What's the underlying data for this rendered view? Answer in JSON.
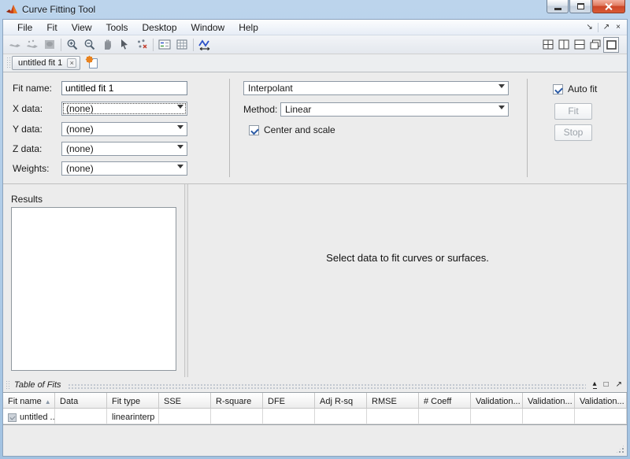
{
  "titlebar": {
    "title": "Curve Fitting Tool"
  },
  "menubar": {
    "items": [
      "File",
      "Fit",
      "View",
      "Tools",
      "Desktop",
      "Window",
      "Help"
    ],
    "dock_glyph": "↘",
    "undock_glyph": "↗",
    "close_glyph": "×"
  },
  "tabbar": {
    "active_tab": "untitled fit 1",
    "close_glyph": "×"
  },
  "fit_panel": {
    "fit_name_label": "Fit name:",
    "fit_name_value": "untitled fit 1",
    "x_data_label": "X data:",
    "x_data_value": "(none)",
    "y_data_label": "Y data:",
    "y_data_value": "(none)",
    "z_data_label": "Z data:",
    "z_data_value": "(none)",
    "weights_label": "Weights:",
    "weights_value": "(none)",
    "fit_type_value": "Interpolant",
    "method_label": "Method:",
    "method_value": "Linear",
    "center_scale_label": "Center and scale",
    "auto_fit_label": "Auto fit",
    "fit_button_label": "Fit",
    "stop_button_label": "Stop"
  },
  "results_panel": {
    "label": "Results"
  },
  "plot_panel": {
    "message": "Select data to fit curves or surfaces."
  },
  "table_of_fits": {
    "title": "Table of Fits",
    "sort_glyph": "▲",
    "collapse_glyph": "▴",
    "maximize_glyph": "□",
    "undock_glyph": "↗",
    "columns": [
      "Fit name",
      "Data",
      "Fit type",
      "SSE",
      "R-square",
      "DFE",
      "Adj R-sq",
      "RMSE",
      "# Coeff",
      "Validation...",
      "Validation...",
      "Validation..."
    ],
    "rows": [
      {
        "cells": [
          "untitled ...",
          "",
          "linearinterp",
          "",
          "",
          "",
          "",
          "",
          "",
          "",
          "",
          ""
        ]
      }
    ]
  }
}
